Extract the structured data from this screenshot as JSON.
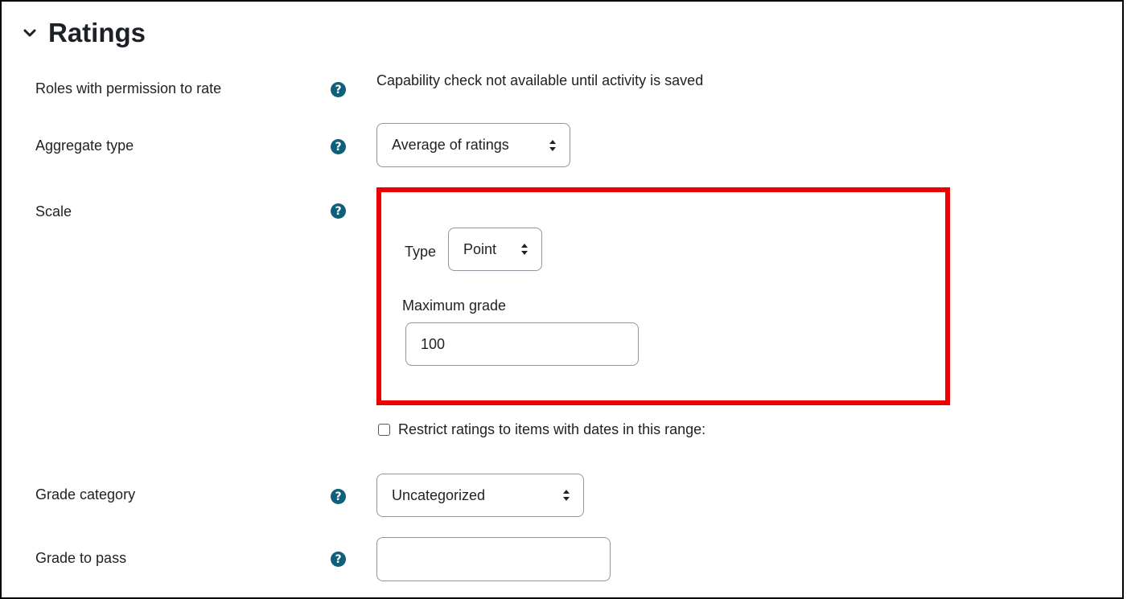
{
  "section": {
    "title": "Ratings"
  },
  "fields": {
    "roles": {
      "label": "Roles with permission to rate",
      "value": "Capability check not available until activity is saved"
    },
    "aggregate": {
      "label": "Aggregate type",
      "selected": "Average of ratings"
    },
    "scale": {
      "label": "Scale",
      "type_label": "Type",
      "type_selected": "Point",
      "max_grade_label": "Maximum grade",
      "max_grade_value": "100"
    },
    "restrict": {
      "label": "Restrict ratings to items with dates in this range:",
      "checked": false
    },
    "grade_category": {
      "label": "Grade category",
      "selected": "Uncategorized"
    },
    "grade_to_pass": {
      "label": "Grade to pass",
      "value": ""
    }
  },
  "icons": {
    "help": "question-circle-icon",
    "collapse": "chevron-down-icon",
    "select_caret": "sort-caret-icon"
  },
  "colors": {
    "help_icon": "#0f5f7a",
    "highlight_border": "#ee0000",
    "field_border": "#8f959e"
  }
}
